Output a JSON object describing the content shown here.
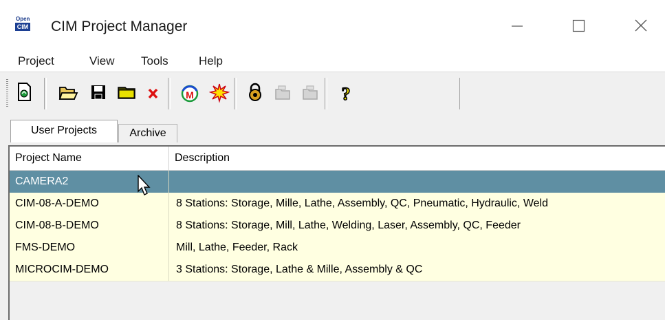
{
  "window": {
    "title": "CIM Project Manager",
    "icon_top": "Open",
    "icon_bottom": "CIM"
  },
  "menu": [
    "Project",
    "View",
    "Tools",
    "Help"
  ],
  "toolbar": [
    "new-project-icon",
    "open-folder-icon",
    "save-icon",
    "copy-project-icon",
    "delete-icon",
    "manager-icon",
    "starburst-icon",
    "lock-icon",
    "archive-icon",
    "restore-icon",
    "help-icon"
  ],
  "tabs": {
    "user": "User Projects",
    "archive": "Archive"
  },
  "table": {
    "columns": [
      "Project Name",
      "Description"
    ],
    "rows": [
      {
        "name": "CAMERA2",
        "description": ""
      },
      {
        "name": "CIM-08-A-DEMO",
        "description": "8 Stations: Storage, Mille, Lathe, Assembly, QC, Pneumatic, Hydraulic, Weld"
      },
      {
        "name": "CIM-08-B-DEMO",
        "description": "8 Stations: Storage, Mill, Lathe, Welding, Laser, Assembly, QC, Feeder"
      },
      {
        "name": "FMS-DEMO",
        "description": "Mill, Lathe, Feeder, Rack"
      },
      {
        "name": "MICROCIM-DEMO",
        "description": "3 Stations: Storage, Lathe & Mille, Assembly & QC"
      }
    ]
  },
  "colors": {
    "selected_row": "#5f8fa3",
    "row_bg": "#ffffe1"
  }
}
